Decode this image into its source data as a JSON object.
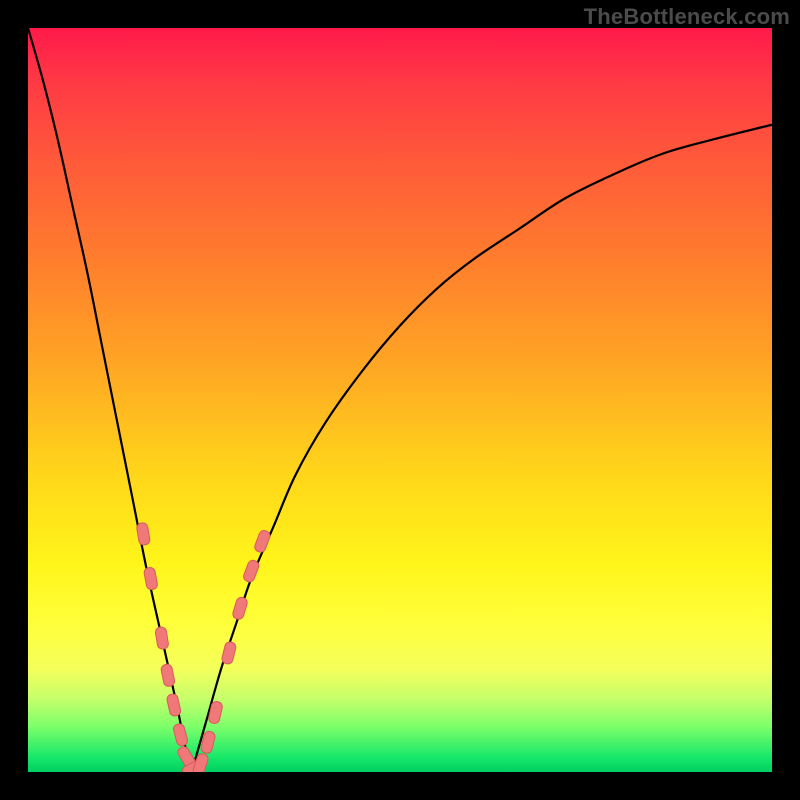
{
  "watermark": "TheBottleneck.com",
  "colors": {
    "frame": "#000000",
    "curve": "#000000",
    "marker_fill": "#f07878",
    "marker_stroke": "#d85a5a",
    "gradient_stops": [
      "#ff1a4a",
      "#ff3c44",
      "#ff5a3a",
      "#ff7a2e",
      "#ffa524",
      "#ffd61a",
      "#fff51a",
      "#ffff3a",
      "#f5ff5a",
      "#c8ff6a",
      "#7aff6a",
      "#17e86a",
      "#00d060"
    ]
  },
  "chart_data": {
    "type": "line",
    "title": "",
    "xlabel": "",
    "ylabel": "",
    "xlim": [
      0,
      100
    ],
    "ylim": [
      0,
      100
    ],
    "axes_visible": false,
    "background": "red-to-green vertical gradient (worse at top, better at bottom)",
    "description": "V-shaped bottleneck curve. Minimum at x≈22. Left branch rises steeply to top-left; right branch rises with decreasing slope toward top-right.",
    "series": [
      {
        "name": "left-branch",
        "x": [
          0,
          2,
          4,
          6,
          8,
          10,
          12,
          14,
          16,
          18,
          20,
          21,
          22
        ],
        "values": [
          100,
          93,
          85,
          76,
          67,
          57,
          47,
          37,
          27,
          18,
          9,
          4,
          0
        ]
      },
      {
        "name": "right-branch",
        "x": [
          22,
          24,
          26,
          28,
          30,
          33,
          36,
          40,
          45,
          50,
          55,
          60,
          66,
          72,
          78,
          85,
          92,
          100
        ],
        "values": [
          0,
          7,
          14,
          20,
          26,
          33,
          40,
          47,
          54,
          60,
          65,
          69,
          73,
          77,
          80,
          83,
          85,
          87
        ]
      }
    ],
    "markers": {
      "name": "sample-points",
      "shape": "rounded-rect",
      "color": "#f07878",
      "points": [
        {
          "x": 15.5,
          "y": 32
        },
        {
          "x": 16.5,
          "y": 26
        },
        {
          "x": 18.0,
          "y": 18
        },
        {
          "x": 18.8,
          "y": 13
        },
        {
          "x": 19.6,
          "y": 9
        },
        {
          "x": 20.5,
          "y": 5
        },
        {
          "x": 21.3,
          "y": 2
        },
        {
          "x": 22.2,
          "y": 0.5
        },
        {
          "x": 23.2,
          "y": 1
        },
        {
          "x": 24.2,
          "y": 4
        },
        {
          "x": 25.2,
          "y": 8
        },
        {
          "x": 27.0,
          "y": 16
        },
        {
          "x": 28.5,
          "y": 22
        },
        {
          "x": 30.0,
          "y": 27
        },
        {
          "x": 31.5,
          "y": 31
        }
      ]
    }
  }
}
